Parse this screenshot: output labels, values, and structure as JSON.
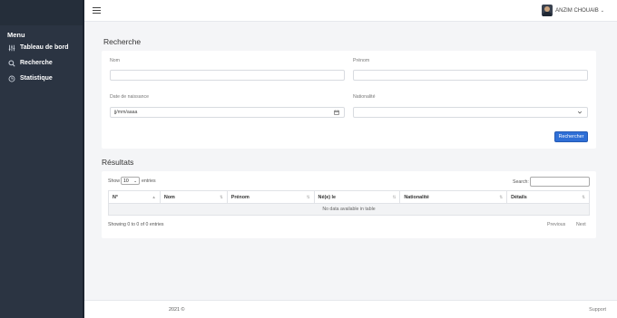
{
  "sidebar": {
    "menu_title": "Menu",
    "items": [
      {
        "label": "Tableau de bord",
        "icon": "sliders-icon"
      },
      {
        "label": "Recherche",
        "icon": "search-icon"
      },
      {
        "label": "Statistique",
        "icon": "clock-icon"
      }
    ]
  },
  "topbar": {
    "user_name": "ANZIM CHOUAIB",
    "caret": "⌄"
  },
  "search": {
    "title": "Recherche",
    "nom_label": "Nom",
    "prenom_label": "Prénom",
    "date_label": "Date de naissance",
    "date_placeholder": "jj/mm/aaaa",
    "nationalite_label": "Nationalité",
    "submit_label": "Rechercher"
  },
  "results": {
    "title": "Résultats",
    "show_label": "Show",
    "entries_value": "10",
    "entries_label": "entries",
    "search_label": "Search:",
    "columns": [
      "N°",
      "Nom",
      "Prénom",
      "Né(e) le",
      "Nationalité",
      "Détails"
    ],
    "empty_message": "No data available in table",
    "info": "Showing 0 to 0 of 0 entries",
    "previous": "Previous",
    "next": "Next"
  },
  "footer": {
    "copyright": "2021 ©",
    "support": "Support"
  },
  "colors": {
    "sidebar": "#2b3442",
    "primary_button": "#2f6fd6",
    "background": "#f4f5f7"
  }
}
